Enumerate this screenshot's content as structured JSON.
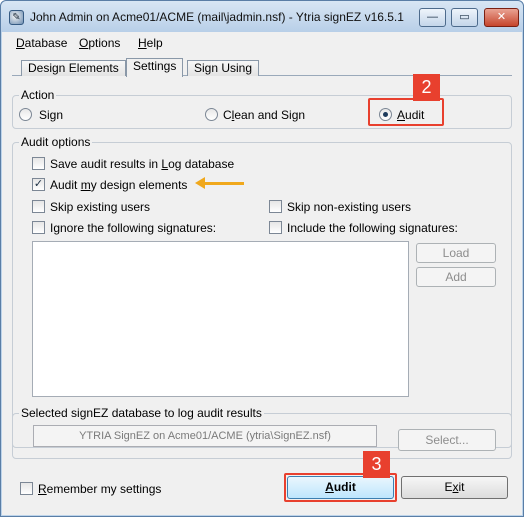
{
  "window": {
    "title": "John Admin on Acme01/ACME (mail\\jadmin.nsf) - Ytria signEZ v16.5.1",
    "icon": "ytria-app-icon",
    "controls": {
      "minimize": "—",
      "maximize": "▭",
      "close": "✕"
    }
  },
  "menu": {
    "items": [
      {
        "label_u": "D",
        "label_rest": "atabase"
      },
      {
        "label_u": "O",
        "label_rest": "ptions"
      },
      {
        "label_u": "H",
        "label_rest": "elp"
      }
    ]
  },
  "tabs": [
    {
      "label": "Design Elements",
      "active": false
    },
    {
      "label": "Settings",
      "active": true
    },
    {
      "label": "Sign Using",
      "active": false
    }
  ],
  "action": {
    "title": "Action",
    "options": [
      {
        "label": "Sign",
        "selected": false
      },
      {
        "label_pre": "C",
        "label_u": "l",
        "label_post": "ean and Sign",
        "selected": false
      },
      {
        "label_u": "A",
        "label_post": "udit",
        "selected": true
      }
    ]
  },
  "audit_options": {
    "title": "Audit options",
    "save_log": {
      "pre": "Save audit results in ",
      "u": "L",
      "post": "og database",
      "checked": false
    },
    "audit_mine": {
      "pre": "Audit ",
      "u": "m",
      "post": "y design elements",
      "checked": true
    },
    "skip_existing": {
      "label": "Skip existing users",
      "checked": false
    },
    "skip_nonexisting": {
      "label": "Skip non-existing users",
      "checked": false
    },
    "ignore_sigs": {
      "label": "Ignore the following signatures:",
      "checked": false
    },
    "include_sigs": {
      "label": "Include the following signatures:",
      "checked": false
    },
    "load_button": "Load",
    "add_button": "Add"
  },
  "log_db": {
    "title": "Selected signEZ database to log audit results",
    "value": "YTRIA SignEZ  on Acme01/ACME (ytria\\SignEZ.nsf)",
    "select_button": "Select..."
  },
  "footer": {
    "remember_pre": "",
    "remember_u": "R",
    "remember_post": "emember my settings",
    "remember_checked": false,
    "audit_button_u": "A",
    "audit_button_rest": "udit",
    "exit_button_pre": "E",
    "exit_button_u": "x",
    "exit_button_post": "it"
  },
  "annotations": {
    "step2": "2",
    "step3": "3",
    "highlight_color": "#e8402e",
    "arrow_color": "#f0a81c"
  }
}
